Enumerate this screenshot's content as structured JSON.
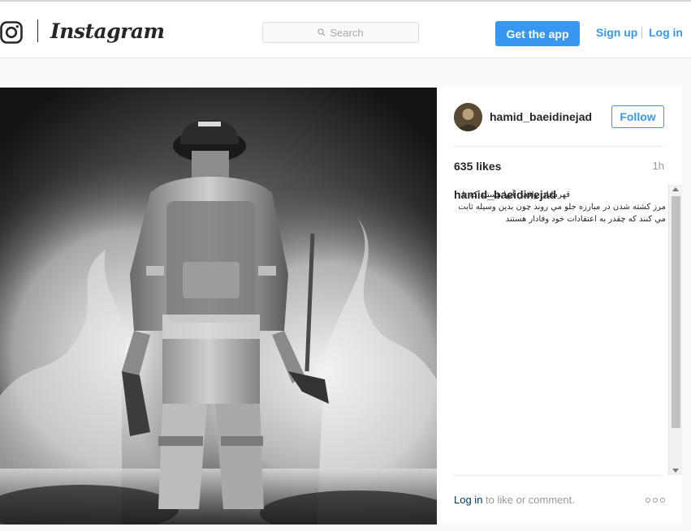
{
  "header": {
    "brand": "Instagram",
    "search_placeholder": "Search",
    "get_app_label": "Get the app",
    "signup_label": "Sign up",
    "login_label": "Log in"
  },
  "post": {
    "username": "hamid_baeidinejad",
    "follow_label": "Follow",
    "likes": "635 likes",
    "timestamp": "1h",
    "caption_user": "hamid_baeidinejad",
    "caption_text": "قهرمانان واقعي آنها هستند كه تا مرز كشته شدن در مبارزه جلو مي روند چون بدين وسيله ثابت مي كنند كه چقدر به اعتقادات خود وفادار هستند",
    "comment_login": "Log in",
    "comment_rest": " to like or comment."
  },
  "colors": {
    "accent": "#3897f0",
    "text": "#262626",
    "muted": "#999999",
    "border": "#e6e6e6"
  },
  "icons": {
    "logo": "instagram-camera-icon",
    "search": "search-icon",
    "more": "more-options-icon"
  }
}
